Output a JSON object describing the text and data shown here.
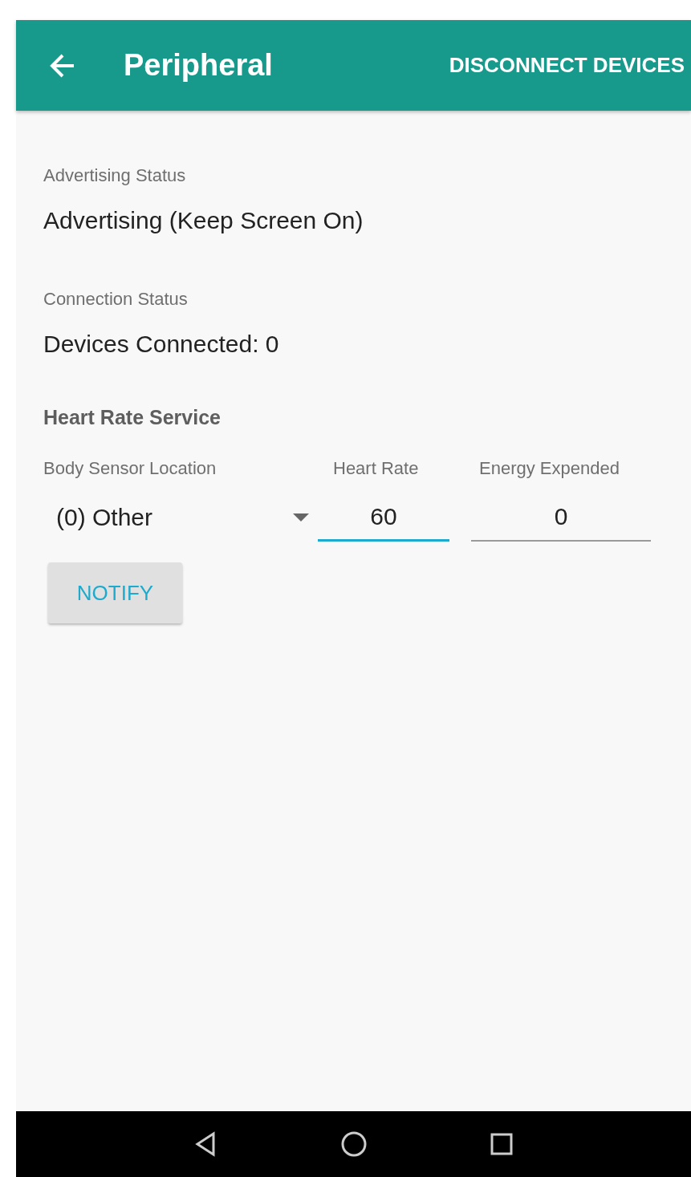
{
  "app_bar": {
    "title": "Peripheral",
    "action": "DISCONNECT DEVICES"
  },
  "sections": [
    {
      "label": "Advertising Status",
      "value": "Advertising (Keep Screen On)"
    },
    {
      "label": "Connection Status",
      "value": "Devices Connected: 0"
    }
  ],
  "service": {
    "title": "Heart Rate Service",
    "fields": [
      {
        "kind": "dropdown",
        "label": "Body Sensor Location",
        "value": "(0) Other",
        "focused": false
      },
      {
        "kind": "number",
        "label": "Heart Rate",
        "value": "60",
        "focused": true
      },
      {
        "kind": "number",
        "label": "Energy Expended",
        "value": "0",
        "focused": false
      }
    ],
    "button": "NOTIFY"
  }
}
